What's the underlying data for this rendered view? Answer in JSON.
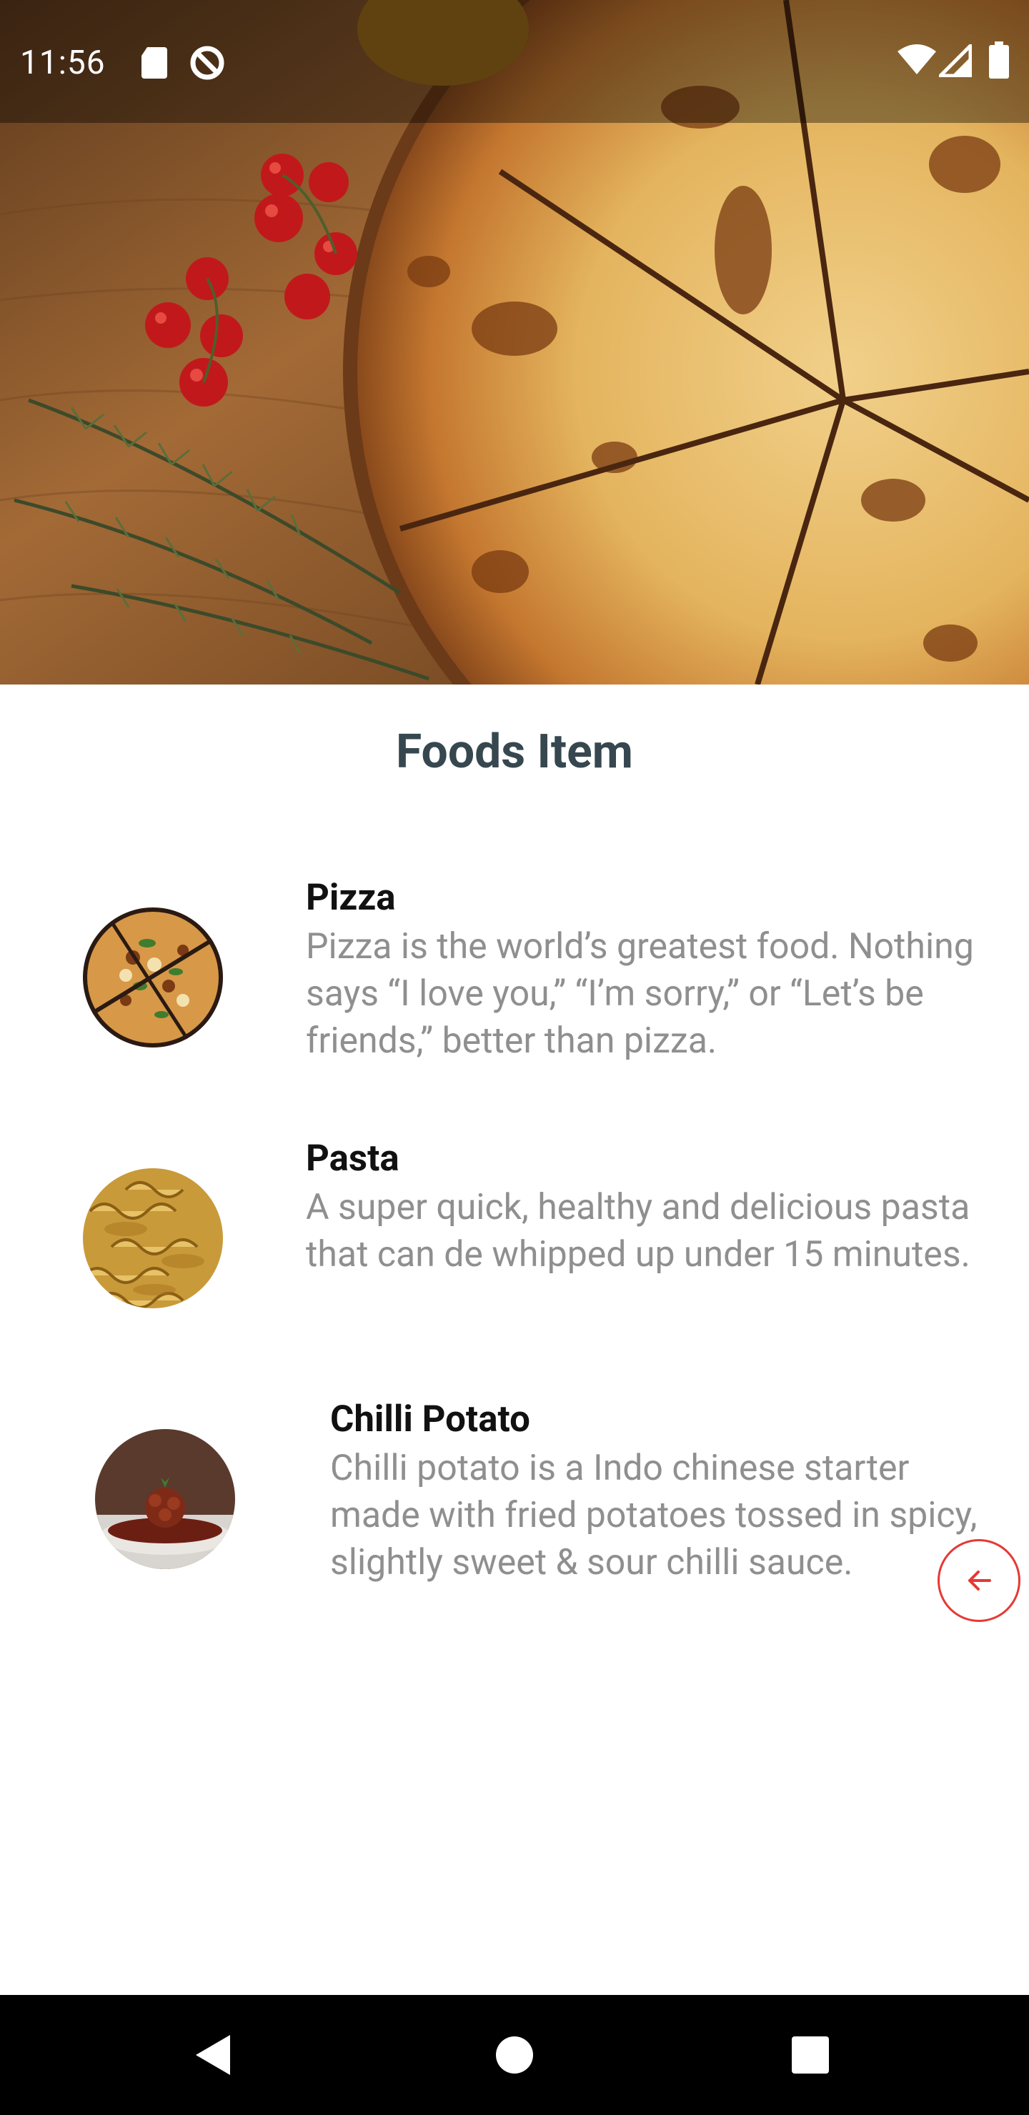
{
  "status_bar": {
    "time": "11:56",
    "icons": [
      "sd-card-icon",
      "data-saver-icon",
      "wifi-icon",
      "signal-icon",
      "battery-icon"
    ]
  },
  "hero": {
    "image": "pizza-hero-image"
  },
  "page": {
    "title": "Foods Item"
  },
  "foods": [
    {
      "name": "Pizza",
      "description": "Pizza is the world’s greatest food. Nothing says “I love you,” “I’m sorry,” or “Let’s be friends,” better than pizza.",
      "image": "pizza-thumbnail"
    },
    {
      "name": "Pasta",
      "description": "A super quick, healthy and delicious pasta that can de whipped up under 15 minutes.",
      "image": "pasta-thumbnail"
    },
    {
      "name": "Chilli Potato",
      "description": "Chilli potato is a Indo chinese starter made with fried potatoes tossed in spicy, slightly sweet & sour chilli sauce.",
      "image": "chilli-potato-thumbnail"
    }
  ],
  "fab": {
    "icon": "arrow-back-icon",
    "color": "#e53935"
  },
  "nav_bar": {
    "buttons": [
      "back-icon",
      "home-icon",
      "recents-icon"
    ]
  },
  "colors": {
    "title": "#37474f",
    "item_name": "#111111",
    "item_desc": "#8f8f8f",
    "accent": "#e53935"
  }
}
